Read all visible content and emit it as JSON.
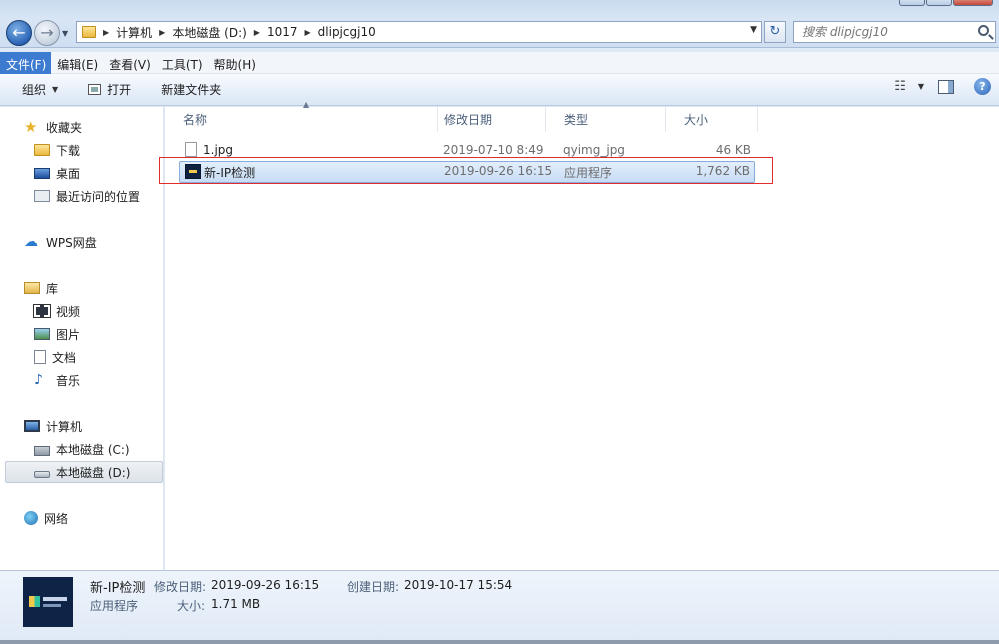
{
  "navigation": {
    "breadcrumbs": [
      "计算机",
      "本地磁盘 (D:)",
      "1017",
      "dlipjcgj10"
    ]
  },
  "search": {
    "placeholder": "搜索 dlipjcgj10"
  },
  "menu": {
    "items": [
      "文件(F)",
      "编辑(E)",
      "查看(V)",
      "工具(T)",
      "帮助(H)"
    ],
    "active_index": 0
  },
  "toolbar": {
    "organize": "组织",
    "open": "打开",
    "new_folder": "新建文件夹"
  },
  "sidebar": {
    "favorites": {
      "label": "收藏夹",
      "items": [
        "下载",
        "桌面",
        "最近访问的位置"
      ]
    },
    "wps": "WPS网盘",
    "libraries": {
      "label": "库",
      "items": [
        "视频",
        "图片",
        "文档",
        "音乐"
      ]
    },
    "computer": {
      "label": "计算机",
      "items": [
        "本地磁盘 (C:)",
        "本地磁盘 (D:)"
      ]
    },
    "network": "网络"
  },
  "columns": [
    "名称",
    "修改日期",
    "类型",
    "大小"
  ],
  "files": [
    {
      "name": "1.jpg",
      "modified": "2019-07-10 8:49",
      "type": "qyimg_jpg",
      "size": "46 KB",
      "icon": "image-file-icon"
    },
    {
      "name": "新-IP检测",
      "modified": "2019-09-26 16:15",
      "type": "应用程序",
      "size": "1,762 KB",
      "icon": "application-icon"
    }
  ],
  "details": {
    "name": "新-IP检测",
    "type": "应用程序",
    "modified_label": "修改日期:",
    "modified": "2019-09-26 16:15",
    "created_label": "创建日期:",
    "created": "2019-10-17 15:54",
    "size_label": "大小:",
    "size": "1.71 MB"
  },
  "colors": {
    "menu_active": "#3d7bd0",
    "selection_border": "#84acdd",
    "highlight_box": "#e22b2b"
  }
}
